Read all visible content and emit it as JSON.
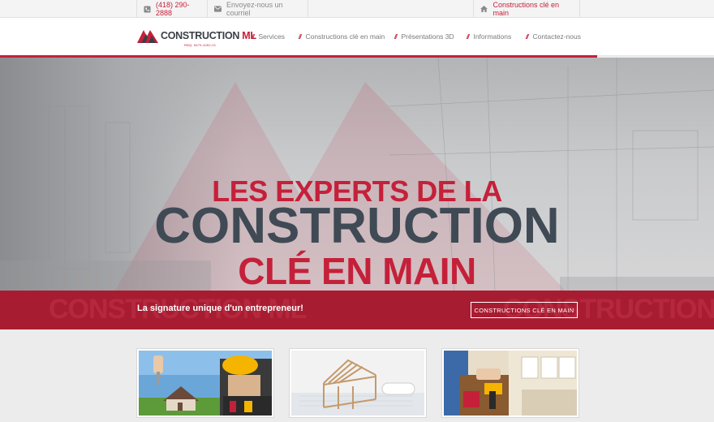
{
  "topbar": {
    "phone": "(418) 290-2888",
    "email_link": "Envoyez-nous un courriel",
    "right_link": "Constructions clé en main",
    "icons": [
      "phone-icon",
      "envelope-icon",
      "home-icon"
    ]
  },
  "header": {
    "logo": {
      "name": "CONSTRUCTION",
      "suffix": "ML",
      "tagline": "RBQ: 5679-4262-01"
    },
    "nav": [
      "Services",
      "Constructions clé en main",
      "Présentations 3D",
      "Informations",
      "Contactez-nous"
    ]
  },
  "hero": {
    "line1": "LES EXPERTS DE LA",
    "line2": "CONSTRUCTION",
    "line3": "CLÉ EN MAIN"
  },
  "banner": {
    "text": "La signature unique d'un entrepreneur!",
    "button": "CONSTRUCTIONS CLÉ EN MAIN",
    "watermark": "CONSTRUCTION ML"
  },
  "cards": [
    {
      "name": "key-house-image"
    },
    {
      "name": "house-frame-image"
    },
    {
      "name": "kitchen-worker-image"
    }
  ],
  "colors": {
    "accent": "#c5203a",
    "dark": "#3f4a55",
    "banner": "#a81c31"
  }
}
